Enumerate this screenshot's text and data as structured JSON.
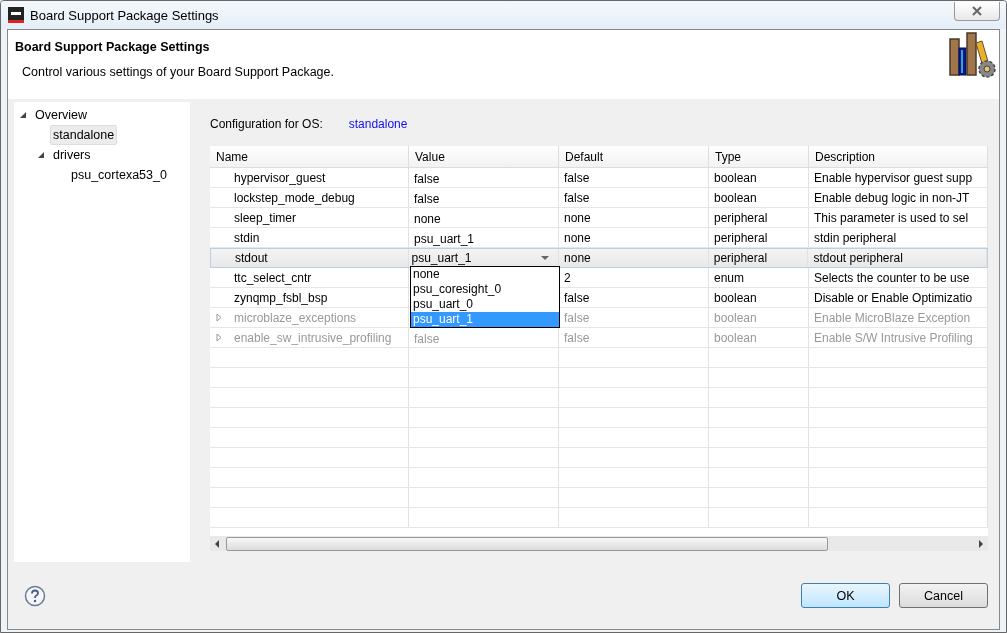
{
  "window": {
    "title": "Board Support Package Settings"
  },
  "header": {
    "title": "Board Support Package Settings",
    "subtitle": "Control various settings of your Board Support Package."
  },
  "tree": [
    {
      "label": "Overview",
      "expanded": true,
      "selected": false,
      "children": [
        {
          "label": "standalone",
          "selected": true
        },
        {
          "label": "drivers",
          "expanded": true,
          "selected": false,
          "children": [
            {
              "label": "psu_cortexa53_0",
              "selected": false
            }
          ]
        }
      ]
    }
  ],
  "config": {
    "label": "Configuration for OS:",
    "os": "standalone"
  },
  "table": {
    "columns": [
      "Name",
      "Value",
      "Default",
      "Type",
      "Description"
    ],
    "rows": [
      {
        "name": "hypervisor_guest",
        "value": "false",
        "default": "false",
        "type": "boolean",
        "description": "Enable hypervisor guest supp",
        "expandable": false,
        "disabled": false,
        "selected": false
      },
      {
        "name": "lockstep_mode_debug",
        "value": "false",
        "default": "false",
        "type": "boolean",
        "description": "Enable debug logic in non-JT",
        "expandable": false,
        "disabled": false,
        "selected": false
      },
      {
        "name": "sleep_timer",
        "value": "none",
        "default": "none",
        "type": "peripheral",
        "description": "This parameter is used to sel",
        "expandable": false,
        "disabled": false,
        "selected": false
      },
      {
        "name": "stdin",
        "value": "psu_uart_1",
        "default": "none",
        "type": "peripheral",
        "description": "stdin peripheral",
        "expandable": false,
        "disabled": false,
        "selected": false
      },
      {
        "name": "stdout",
        "value": "psu_uart_1",
        "default": "none",
        "type": "peripheral",
        "description": "stdout peripheral",
        "expandable": false,
        "disabled": false,
        "selected": true
      },
      {
        "name": "ttc_select_cntr",
        "default": "2",
        "type": "enum",
        "description": "Selects the counter to be use",
        "expandable": false,
        "disabled": false,
        "selected": false
      },
      {
        "name": "zynqmp_fsbl_bsp",
        "default": "false",
        "type": "boolean",
        "description": "Disable or Enable Optimizatio",
        "expandable": false,
        "disabled": false,
        "selected": false
      },
      {
        "name": "microblaze_exceptions",
        "default": "false",
        "type": "boolean",
        "description": "Enable MicroBlaze Exception",
        "expandable": true,
        "disabled": true,
        "selected": false
      },
      {
        "name": "enable_sw_intrusive_profiling",
        "value": "false",
        "default": "false",
        "type": "boolean",
        "description": "Enable S/W Intrusive Profiling",
        "expandable": true,
        "disabled": true,
        "selected": false
      }
    ]
  },
  "dropdown": {
    "options": [
      {
        "label": "none",
        "selected": false
      },
      {
        "label": "psu_coresight_0",
        "selected": false
      },
      {
        "label": "psu_uart_0",
        "selected": false
      },
      {
        "label": "psu_uart_1",
        "selected": true
      }
    ]
  },
  "buttons": [
    {
      "label": "OK",
      "default": true
    },
    {
      "label": "Cancel",
      "default": false
    }
  ]
}
